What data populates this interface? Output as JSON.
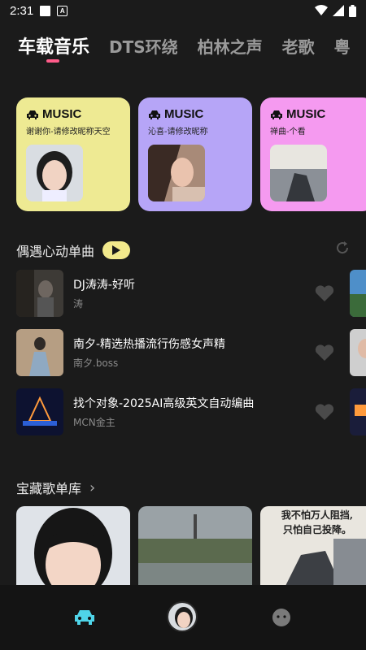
{
  "status": {
    "time": "2:31"
  },
  "tabs": [
    {
      "label": "车载音乐"
    },
    {
      "label": "DTS环绕"
    },
    {
      "label": "柏林之声"
    },
    {
      "label": "老歌"
    },
    {
      "label": "粤"
    }
  ],
  "cards": [
    {
      "brand": "MUSIC",
      "subtitle": "谢谢你-请修改昵称天空",
      "color": "#eeea93"
    },
    {
      "brand": "MUSIC",
      "subtitle": "沁喜-请修改昵称",
      "color": "#b6a5f7"
    },
    {
      "brand": "MUSIC",
      "subtitle": "禅曲-个看",
      "color": "#f59af0"
    }
  ],
  "recommend": {
    "title": "偶遇心动单曲"
  },
  "songs": [
    {
      "title": "DJ涛涛-好听",
      "artist": "涛"
    },
    {
      "title": "南夕-精选热播流行伤感女声精",
      "artist": "南夕.boss"
    },
    {
      "title": "找个对象-2025AI高级英文自动编曲",
      "artist": "MCN金主"
    }
  ],
  "library": {
    "title": "宝藏歌单库",
    "arrow": "›"
  },
  "poster_text": {
    "line1": "我不怕万人阻挡,",
    "line2": "只怕自己投降。"
  }
}
